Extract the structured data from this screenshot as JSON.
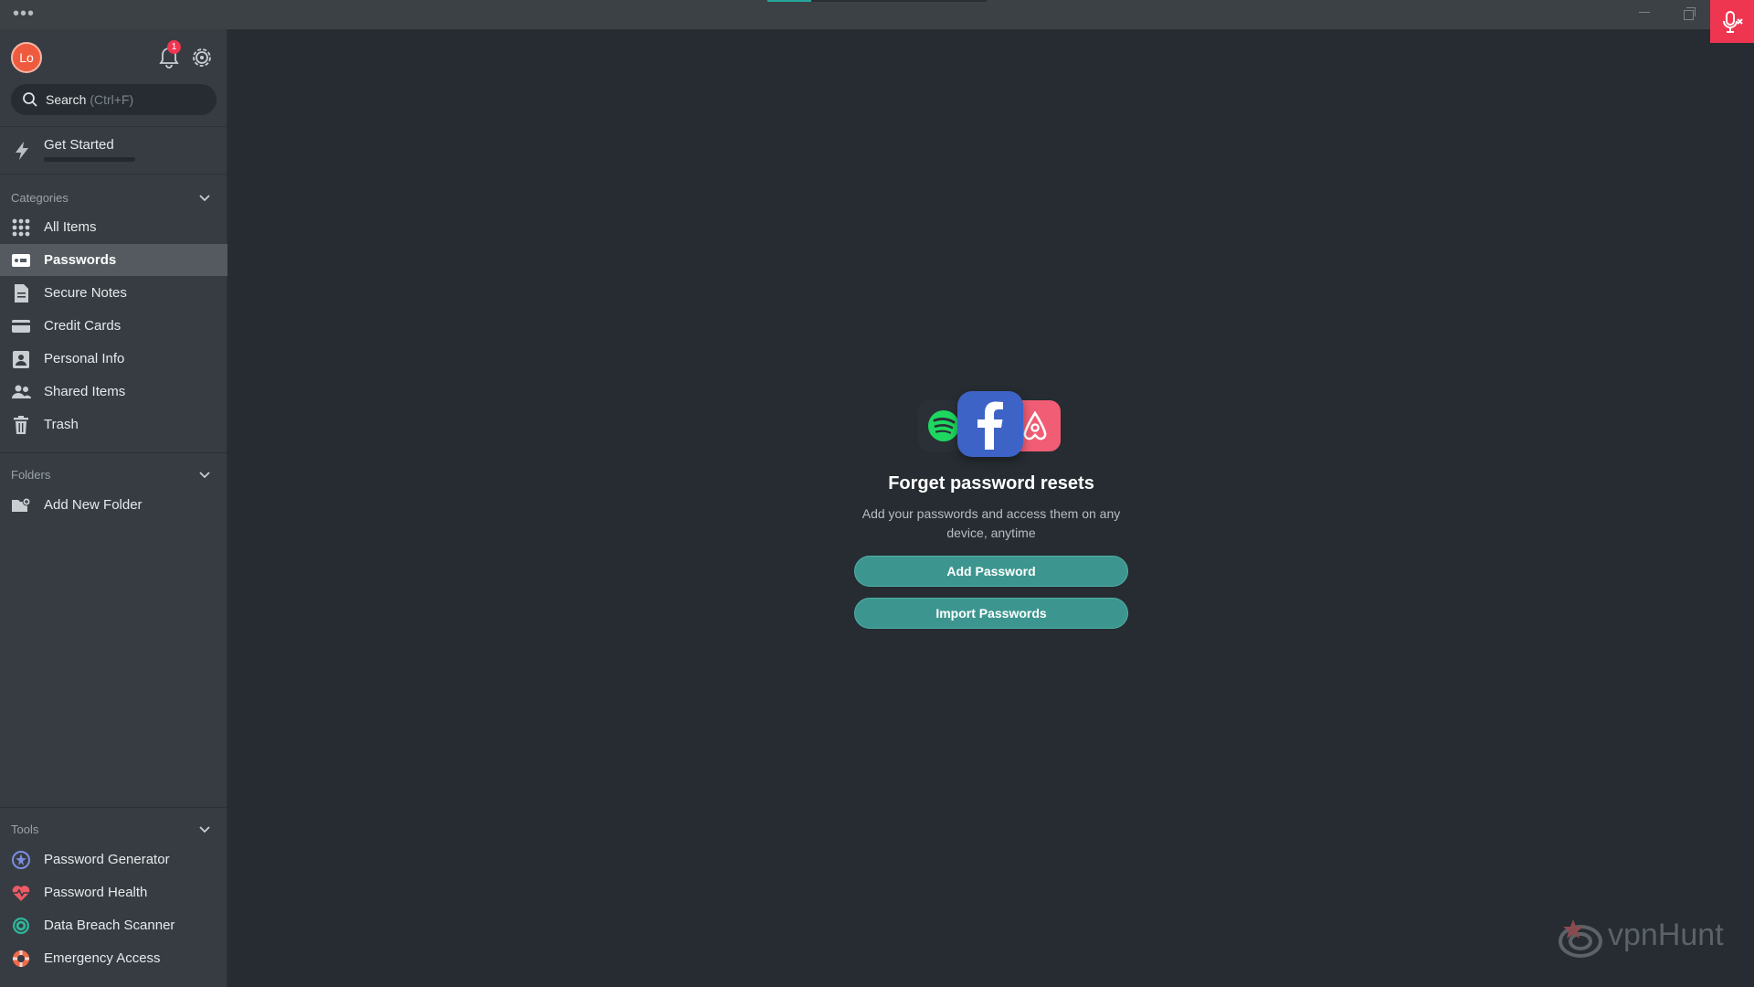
{
  "window": {
    "menu_dots": "•••",
    "colors": {
      "accent": "#26a69a",
      "close_bg": "#ef3650"
    }
  },
  "header": {
    "avatar_initials": "Lo",
    "notification_count": "1",
    "search_placeholder": "Search",
    "search_shortcut": "(Ctrl+F)"
  },
  "get_started": {
    "label": "Get Started",
    "progress": 0
  },
  "categories": {
    "heading": "Categories",
    "items": [
      {
        "label": "All Items",
        "icon": "grid-icon"
      },
      {
        "label": "Passwords",
        "icon": "password-card-icon",
        "active": true
      },
      {
        "label": "Secure Notes",
        "icon": "note-icon"
      },
      {
        "label": "Credit Cards",
        "icon": "credit-card-icon"
      },
      {
        "label": "Personal Info",
        "icon": "id-badge-icon"
      },
      {
        "label": "Shared Items",
        "icon": "people-icon"
      },
      {
        "label": "Trash",
        "icon": "trash-icon"
      }
    ]
  },
  "folders": {
    "heading": "Folders",
    "items": [
      {
        "label": "Add New Folder",
        "icon": "folder-add-icon"
      }
    ]
  },
  "tools": {
    "heading": "Tools",
    "items": [
      {
        "label": "Password Generator",
        "icon": "generator-icon"
      },
      {
        "label": "Password Health",
        "icon": "heart-pulse-icon"
      },
      {
        "label": "Data Breach Scanner",
        "icon": "radar-icon"
      },
      {
        "label": "Emergency Access",
        "icon": "lifebuoy-icon"
      }
    ]
  },
  "main": {
    "empty_title": "Forget password resets",
    "empty_subtitle_line1": "Add your passwords and access them on any",
    "empty_subtitle_line2": "device, anytime",
    "add_button": "Add Password",
    "import_button": "Import Passwords"
  },
  "watermark": {
    "text": "vpnHunt"
  }
}
